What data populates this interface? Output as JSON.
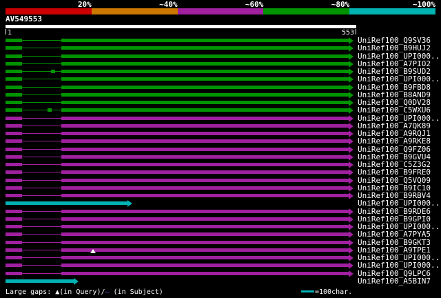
{
  "chart_data": {
    "type": "bar",
    "subtype": "blast-hit-overview",
    "orientation": "horizontal",
    "scale": {
      "segments": [
        {
          "label": "20%",
          "color": "#cc0000"
        },
        {
          "label": "~40%",
          "color": "#cc7700"
        },
        {
          "label": "~60%",
          "color": "#a020a0"
        },
        {
          "label": "~80%",
          "color": "#009400"
        },
        {
          "label": "~100%",
          "color": "#00b2b2"
        }
      ]
    },
    "query": {
      "name": "AV549553",
      "start_label": "1",
      "end_label": "553",
      "length": 553
    },
    "palette": {
      "green": "#009400",
      "magenta": "#a020a0",
      "cyan": "#00b2b2"
    },
    "hits": [
      {
        "label": "UniRef100_Q9SV36",
        "color": "green",
        "start": 1,
        "end": 553,
        "gap": [
          28,
          91
        ]
      },
      {
        "label": "UniRef100_B9HUJ2",
        "color": "green",
        "start": 1,
        "end": 553,
        "gap": [
          28,
          91
        ]
      },
      {
        "label": "UniRef100_UPI000..",
        "color": "green",
        "start": 1,
        "end": 553,
        "gap": [
          28,
          91
        ]
      },
      {
        "label": "UniRef100_A7PIO2",
        "color": "green",
        "start": 1,
        "end": 553,
        "gap": [
          28,
          91
        ]
      },
      {
        "label": "UniRef100_B9SUD2",
        "color": "green",
        "start": 1,
        "end": 553,
        "gap": [
          28,
          91
        ],
        "blip": 78
      },
      {
        "label": "UniRef100_UPI000..",
        "color": "green",
        "start": 1,
        "end": 553,
        "gap": [
          28,
          91
        ]
      },
      {
        "label": "UniRef100_B9FBD8",
        "color": "green",
        "start": 1,
        "end": 553,
        "gap": [
          28,
          91
        ]
      },
      {
        "label": "UniRef100_B8AND9",
        "color": "green",
        "start": 1,
        "end": 553,
        "gap": [
          28,
          91
        ]
      },
      {
        "label": "UniRef100_Q0DV28",
        "color": "green",
        "start": 1,
        "end": 553,
        "gap": [
          28,
          91
        ]
      },
      {
        "label": "UniRef100_C5WXU6",
        "color": "green",
        "start": 1,
        "end": 553,
        "gap": [
          28,
          91
        ],
        "blip": 72
      },
      {
        "label": "UniRef100_UPI000..",
        "color": "magenta",
        "start": 1,
        "end": 553,
        "gap": [
          28,
          91
        ]
      },
      {
        "label": "UniRef100_A7QK89",
        "color": "magenta",
        "start": 1,
        "end": 553,
        "gap": [
          28,
          91
        ]
      },
      {
        "label": "UniRef100_A9RQJ1",
        "color": "magenta",
        "start": 1,
        "end": 553,
        "gap": [
          28,
          91
        ]
      },
      {
        "label": "UniRef100_A9RKE8",
        "color": "magenta",
        "start": 1,
        "end": 553,
        "gap": [
          28,
          91
        ]
      },
      {
        "label": "UniRef100_Q9FZ06",
        "color": "magenta",
        "start": 1,
        "end": 553,
        "gap": [
          28,
          91
        ]
      },
      {
        "label": "UniRef100_B9GVU4",
        "color": "magenta",
        "start": 1,
        "end": 553,
        "gap": [
          28,
          91
        ]
      },
      {
        "label": "UniRef100_C5Z3G2",
        "color": "magenta",
        "start": 1,
        "end": 553,
        "gap": [
          28,
          91
        ]
      },
      {
        "label": "UniRef100_B9FRE0",
        "color": "magenta",
        "start": 1,
        "end": 553,
        "gap": [
          28,
          91
        ]
      },
      {
        "label": "UniRef100_Q5VQ09",
        "color": "magenta",
        "start": 1,
        "end": 553,
        "gap": [
          28,
          91
        ]
      },
      {
        "label": "UniRef100_B9IC10",
        "color": "magenta",
        "start": 1,
        "end": 553,
        "gap": [
          28,
          91
        ]
      },
      {
        "label": "UniRef100_B9RBV4",
        "color": "magenta",
        "start": 1,
        "end": 553,
        "gap": [
          28,
          91
        ]
      },
      {
        "label": "UniRef100_UPI000..",
        "color": "cyan",
        "start": 1,
        "end": 197
      },
      {
        "label": "UniRef100_B9RDE6",
        "color": "magenta",
        "start": 1,
        "end": 553,
        "gap": [
          28,
          91
        ]
      },
      {
        "label": "UniRef100_B9GPI0",
        "color": "magenta",
        "start": 1,
        "end": 553,
        "gap": [
          28,
          91
        ]
      },
      {
        "label": "UniRef100_UPI000..",
        "color": "magenta",
        "start": 1,
        "end": 553,
        "gap": [
          28,
          91
        ]
      },
      {
        "label": "UniRef100_A7PYA5",
        "color": "magenta",
        "start": 1,
        "end": 553,
        "gap": [
          28,
          91
        ]
      },
      {
        "label": "UniRef100_B9GKT3",
        "color": "magenta",
        "start": 1,
        "end": 553,
        "gap": [
          28,
          91
        ]
      },
      {
        "label": "UniRef100_A9TPE1",
        "color": "magenta",
        "start": 1,
        "end": 553,
        "gap": [
          28,
          91
        ],
        "query_gap_marker_at": 142
      },
      {
        "label": "UniRef100_UPI000..",
        "color": "magenta",
        "start": 1,
        "end": 553,
        "gap": [
          28,
          91
        ]
      },
      {
        "label": "UniRef100_UPI000..",
        "color": "magenta",
        "start": 1,
        "end": 553,
        "gap": [
          28,
          91
        ]
      },
      {
        "label": "UniRef100_Q9LPC6",
        "color": "magenta",
        "start": 1,
        "end": 553,
        "gap": [
          28,
          91
        ]
      },
      {
        "label": "UniRef100_A5BIN7",
        "color": "cyan",
        "start": 1,
        "end": 111
      }
    ],
    "legend": {
      "left_pre": "Large gaps: ▲(in Query)/",
      "subject_dash": "–",
      "subject_dash_color": "#6666ff",
      "left_post": " (in Subject)",
      "right_label": "=100char."
    }
  }
}
